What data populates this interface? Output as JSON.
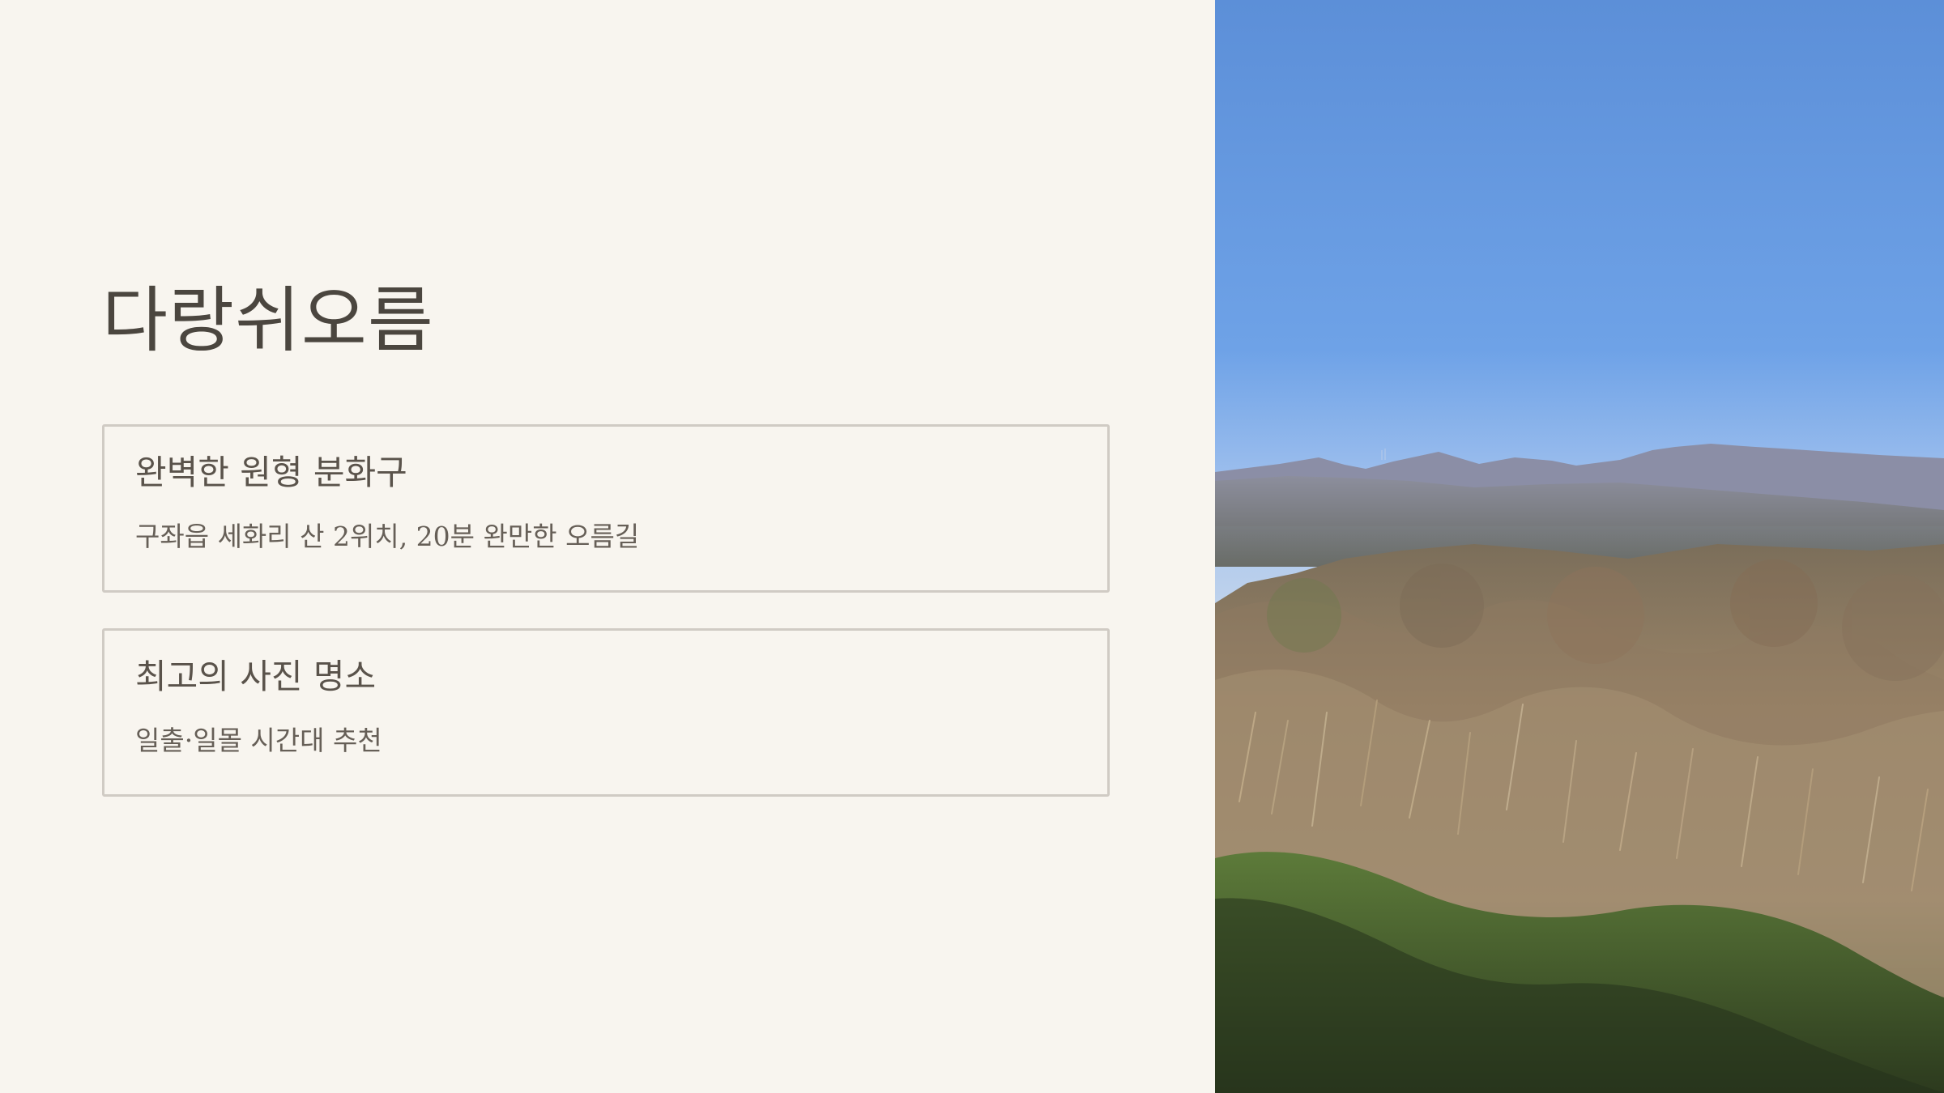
{
  "slide": {
    "title": "다랑쉬오름",
    "cards": [
      {
        "heading": "완벽한 원형 분화구",
        "text": "구좌읍 세화리 산 2위치, 20분 완만한 오름길"
      },
      {
        "heading": "최고의 사진 명소",
        "text": "일출·일몰 시간대 추천"
      }
    ]
  },
  "photo": {
    "description": "",
    "icon": "landscape-photo"
  },
  "colors": {
    "background": "#f8f5ef",
    "title": "#4b463f",
    "card_border": "#d0cbc4",
    "card_heading": "#5a534b",
    "card_text": "#665f57",
    "sky_top": "#5c8fd8",
    "sky_bottom": "#c6d6ea"
  }
}
